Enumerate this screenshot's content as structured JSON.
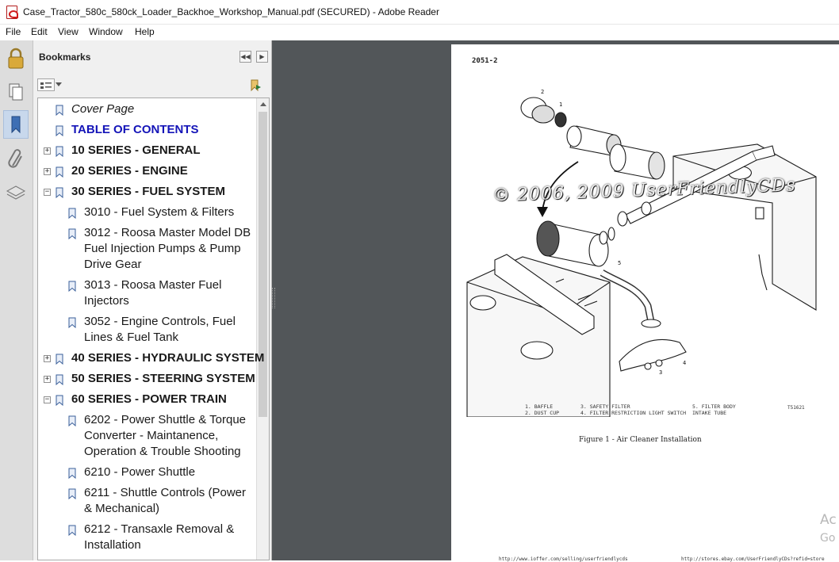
{
  "window": {
    "title": "Case_Tractor_580c_580ck_Loader_Backhoe_Workshop_Manual.pdf (SECURED) - Adobe Reader"
  },
  "menu": [
    "File",
    "Edit",
    "View",
    "Window",
    "Help"
  ],
  "panel": {
    "header": "Bookmarks",
    "bookmarks": [
      {
        "label": "Cover Page"
      },
      {
        "label": "TABLE OF CONTENTS"
      },
      {
        "label": "10 SERIES - GENERAL"
      },
      {
        "label": "20 SERIES - ENGINE"
      },
      {
        "label": "30 SERIES - FUEL SYSTEM"
      },
      {
        "label": "3010 - Fuel System & Filters"
      },
      {
        "lines": [
          "3012 - Roosa Master Model DB",
          "Fuel Injection Pumps & Pump",
          "Drive Gear"
        ]
      },
      {
        "lines": [
          "3013 - Roosa Master Fuel",
          "Injectors"
        ]
      },
      {
        "lines": [
          "3052 - Engine Controls, Fuel",
          "Lines & Fuel Tank"
        ]
      },
      {
        "label": "40 SERIES - HYDRAULIC SYSTEM"
      },
      {
        "label": "50 SERIES - STEERING SYSTEM"
      },
      {
        "label": "60 SERIES - POWER TRAIN"
      },
      {
        "lines": [
          "6202 - Power Shuttle & Torque",
          "Converter - Maintanence,",
          "Operation & Trouble Shooting"
        ]
      },
      {
        "label": "6210 - Power Shuttle"
      },
      {
        "lines": [
          "6211 - Shuttle Controls (Power",
          "& Mechanical)"
        ]
      },
      {
        "lines": [
          "6212 - Transaxle Removal &",
          "Installation"
        ]
      }
    ]
  },
  "page": {
    "number": "2051-2",
    "watermark": "© 2006, 2009 UserFriendlyCDs",
    "legend": {
      "col1": [
        "1.  BAFFLE",
        "2.  DUST CUP"
      ],
      "col2": [
        "3.  SAFETY FILTER",
        "4.  FILTER RESTRICTION LIGHT SWITCH"
      ],
      "col3": [
        "5.  FILTER BODY",
        "    INTAKE TUBE"
      ]
    },
    "drawing_code": "T51621",
    "caption": "Figure 1 - Air Cleaner Installation",
    "callouts": [
      "1",
      "2",
      "3",
      "4",
      "5"
    ],
    "footer_left": "http://www.ioffer.com/selling/userfriendlycds",
    "footer_right": "http://stores.ebay.com/UserFriendlyCDs?refid=store"
  },
  "overlay": {
    "line1": "Ac",
    "line2": "Go"
  },
  "icons": [
    "lock-icon",
    "pages-icon",
    "bookmark-icon",
    "attachment-icon",
    "layers-icon"
  ]
}
